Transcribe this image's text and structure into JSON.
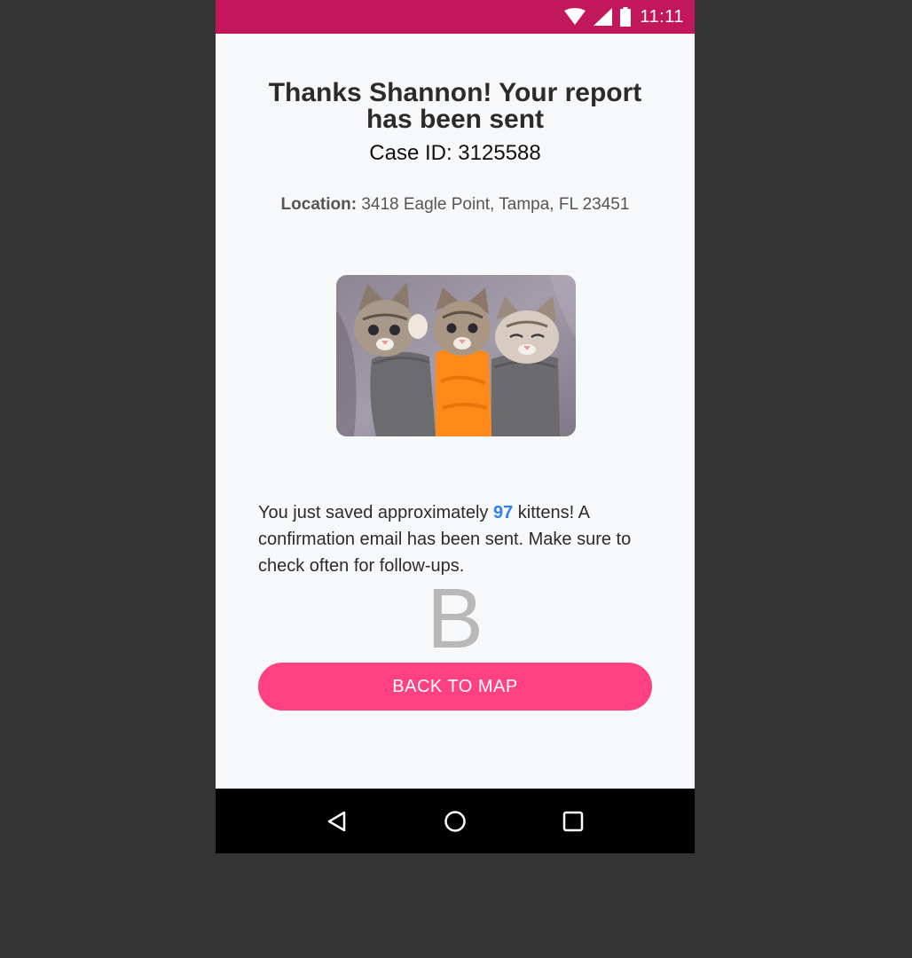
{
  "status_bar": {
    "time": "11:11",
    "icons": [
      "wifi-icon",
      "cellular-signal-icon",
      "battery-icon"
    ],
    "background": "#c2185b"
  },
  "confirmation": {
    "title": "Thanks Shannon! Your report has been sent",
    "case_id": "Case ID: 3125588",
    "location_label": "Location:",
    "location_value": "3418 Eagle Point, Tampa, FL 23451",
    "image_subject": "three kittens wrapped in sweaters",
    "message_before": "You just saved approximately ",
    "kitten_count": "97",
    "message_after": " kittens! A confirmation email has been sent. Make sure to check often for follow-ups.",
    "letter": "B"
  },
  "actions": {
    "back_label": "BACK TO MAP"
  },
  "nav_bar": {
    "icons": [
      "back-icon",
      "home-icon",
      "recents-icon"
    ]
  },
  "colors": {
    "accent": "#ff4081",
    "highlight": "#2f80ed",
    "nav_background": "#000000"
  }
}
